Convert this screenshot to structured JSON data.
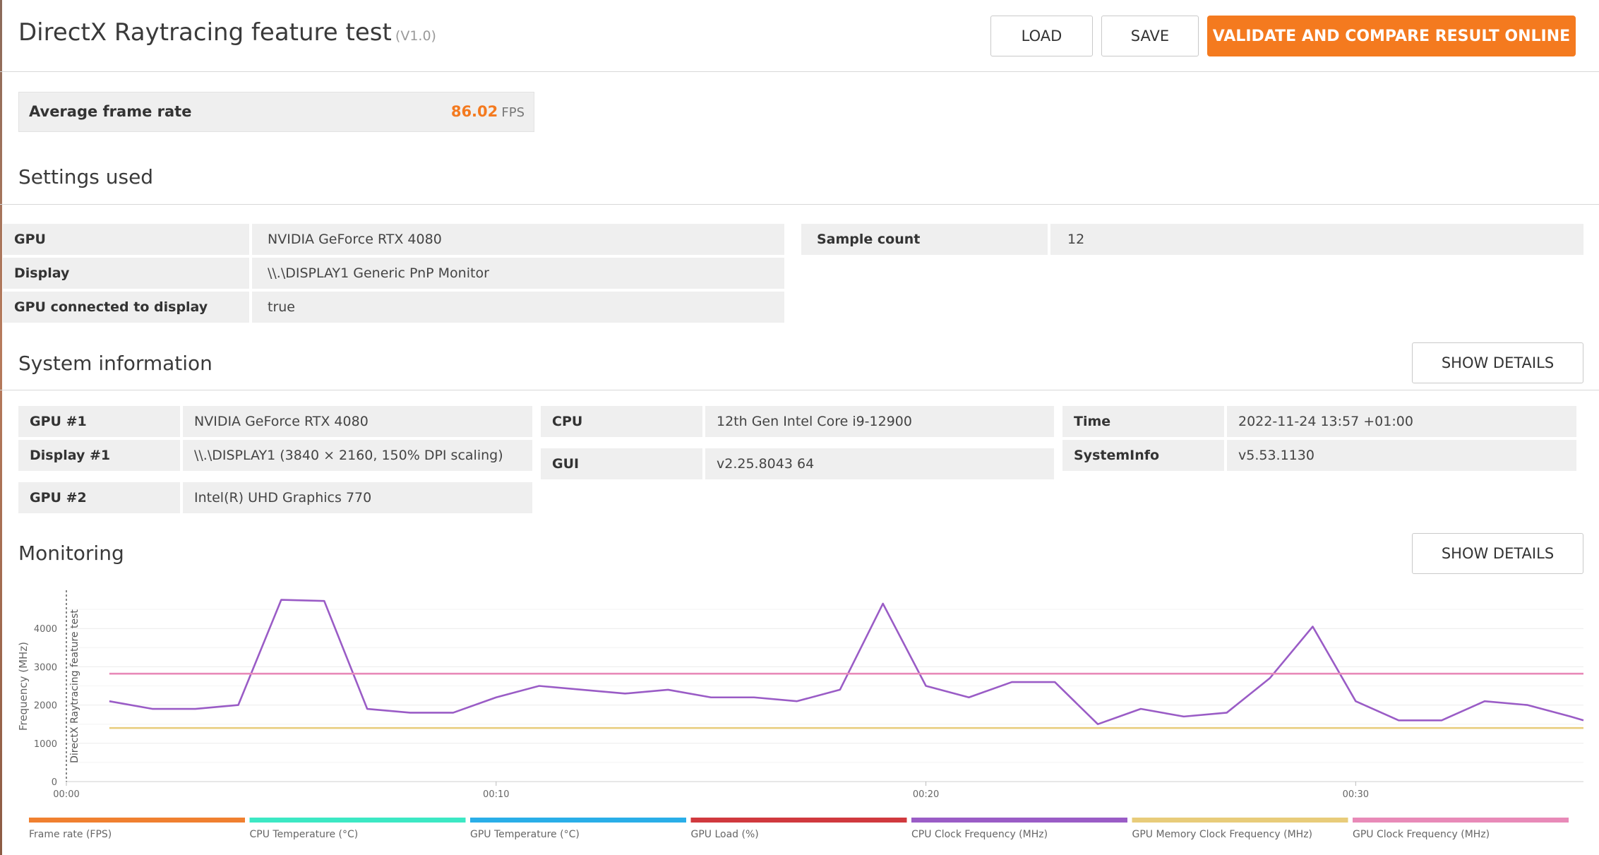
{
  "header": {
    "title": "DirectX Raytracing feature test",
    "version": "(V1.0)",
    "load_label": "LOAD",
    "save_label": "SAVE",
    "validate_label": "VALIDATE AND COMPARE RESULT ONLINE"
  },
  "result": {
    "label": "Average frame rate",
    "value": "86.02",
    "unit": "FPS"
  },
  "settings": {
    "title": "Settings used",
    "rows": [
      {
        "label": "GPU",
        "value": "NVIDIA GeForce RTX 4080"
      },
      {
        "label": "Display",
        "value": "\\\\.\\DISPLAY1 Generic PnP Monitor"
      },
      {
        "label": "GPU connected to display",
        "value": "true"
      }
    ],
    "sample": {
      "label": "Sample count",
      "value": "12"
    }
  },
  "system": {
    "title": "System information",
    "show_details": "SHOW DETAILS",
    "col1": [
      {
        "label": "GPU #1",
        "value": "NVIDIA GeForce RTX 4080"
      },
      {
        "label": "Display #1",
        "value": "\\\\.\\DISPLAY1 (3840 × 2160, 150% DPI scaling)"
      },
      {
        "label": "GPU #2",
        "value": "Intel(R) UHD Graphics 770"
      }
    ],
    "col2": [
      {
        "label": "CPU",
        "value": "12th Gen Intel Core i9-12900"
      },
      {
        "label": "GUI",
        "value": "v2.25.8043 64"
      }
    ],
    "col3": [
      {
        "label": "Time",
        "value": "2022-11-24 13:57 +01:00"
      },
      {
        "label": "SystemInfo",
        "value": "v5.53.1130"
      }
    ]
  },
  "monitoring": {
    "title": "Monitoring",
    "show_details": "SHOW DETAILS"
  },
  "chart_data": {
    "type": "line",
    "ylabel": "Frequency (MHz)",
    "annotation": "DirectX Raytracing feature test",
    "ylim": [
      0,
      5000
    ],
    "y_ticks": [
      0,
      1000,
      2000,
      3000,
      4000
    ],
    "xlim": [
      0,
      35.3
    ],
    "x_ticks": [
      "00:00",
      "00:10",
      "00:20",
      "00:30"
    ],
    "x_tick_seconds": [
      0,
      10,
      20,
      30
    ],
    "grid": true,
    "legend_position": "bottom",
    "series": [
      {
        "name": "Frame rate (FPS)",
        "color": "#f08030",
        "x": [],
        "values": []
      },
      {
        "name": "CPU Temperature (°C)",
        "color": "#3ce8c4",
        "x": [],
        "values": []
      },
      {
        "name": "GPU Temperature (°C)",
        "color": "#2aaee8",
        "x": [],
        "values": []
      },
      {
        "name": "GPU Load (%)",
        "color": "#d0393e",
        "x": [],
        "values": []
      },
      {
        "name": "CPU Clock Frequency (MHz)",
        "color": "#9a5cc6",
        "x": [
          1,
          2,
          3,
          4,
          5,
          6,
          7,
          8,
          9,
          10,
          11,
          12,
          13,
          14,
          15,
          16,
          17,
          18,
          19,
          20,
          21,
          22,
          23,
          24,
          25,
          26,
          27,
          28,
          29,
          30,
          31,
          32,
          33,
          34,
          35,
          35.3
        ],
        "values": [
          2100,
          1900,
          1900,
          2000,
          4750,
          4720,
          1900,
          1800,
          1800,
          2200,
          2500,
          2400,
          2300,
          2400,
          2200,
          2200,
          2100,
          2400,
          4650,
          2500,
          2200,
          2600,
          2600,
          1500,
          1900,
          1700,
          1800,
          2700,
          4050,
          2100,
          1600,
          1600,
          2100,
          2000,
          1700,
          1600
        ]
      },
      {
        "name": "GPU Memory Clock Frequency (MHz)",
        "color": "#e8cc7a",
        "x": [
          1,
          35.3
        ],
        "values": [
          1400,
          1400
        ]
      },
      {
        "name": "GPU Clock Frequency (MHz)",
        "color": "#e88ab8",
        "x": [
          1,
          35.3
        ],
        "values": [
          2820,
          2820
        ]
      }
    ]
  }
}
